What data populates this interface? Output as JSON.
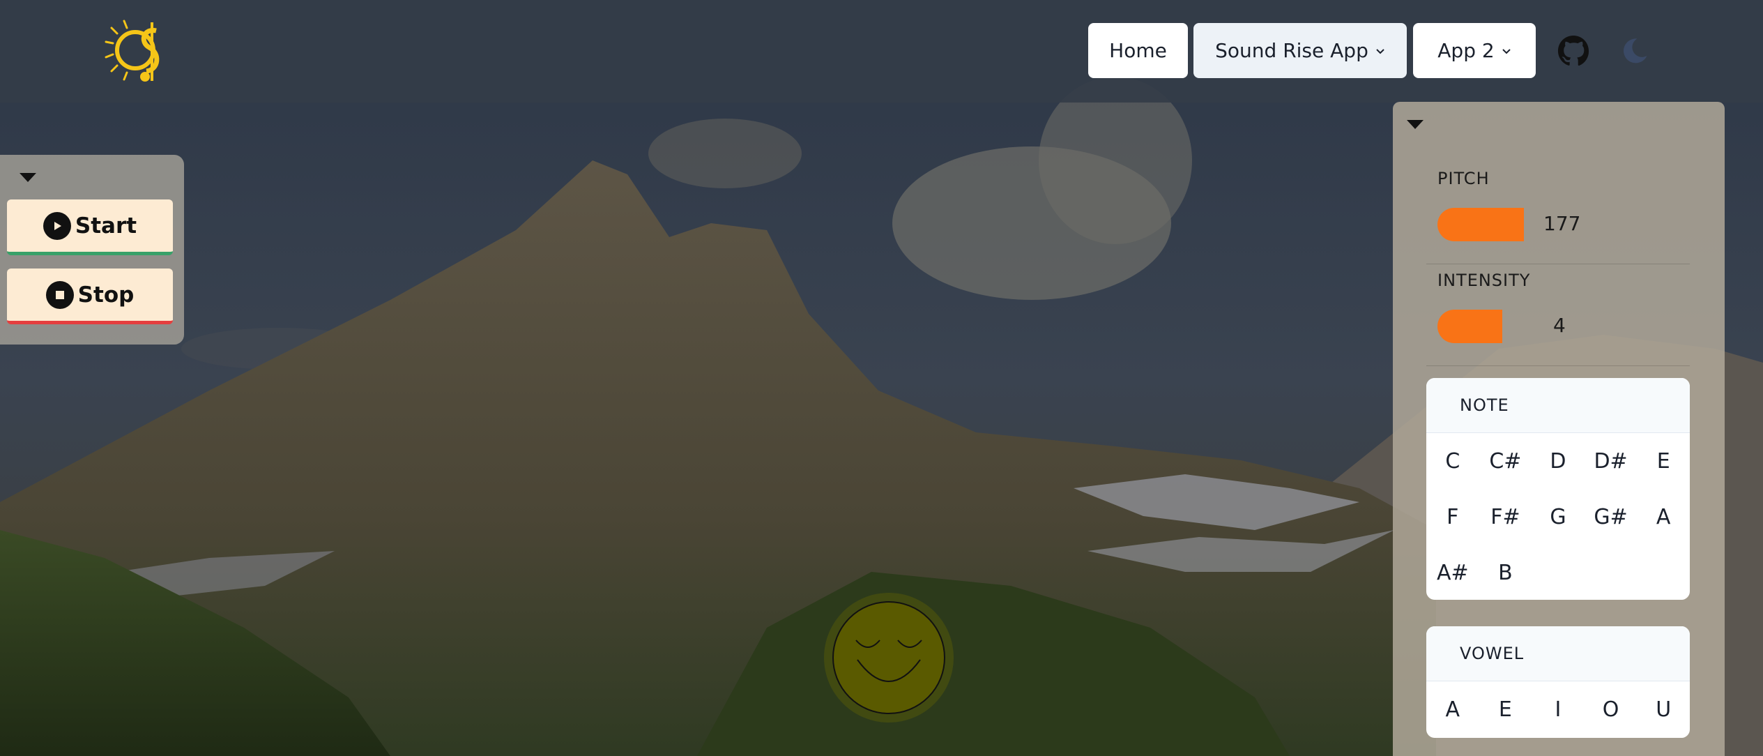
{
  "nav": {
    "home_label": "Home",
    "app1_label": "Sound Rise App",
    "app2_label": "App 2",
    "github_icon": "github-icon",
    "theme_icon": "moon-icon"
  },
  "controls": {
    "start_label": "Start",
    "stop_label": "Stop",
    "start_color": "#38a169",
    "stop_color": "#e53e3e"
  },
  "meters": {
    "pitch_label": "PITCH",
    "pitch_value": "177",
    "intensity_label": "INTENSITY",
    "intensity_value": "4",
    "bar_color": "#f97316"
  },
  "note": {
    "title": "NOTE",
    "options": [
      "C",
      "C#",
      "D",
      "D#",
      "E",
      "F",
      "F#",
      "G",
      "G#",
      "A",
      "A#",
      "B"
    ]
  },
  "vowel": {
    "title": "VOWEL",
    "options": [
      "A",
      "E",
      "I",
      "O",
      "U"
    ]
  },
  "colors": {
    "accent": "#f97316",
    "logo": "#f5c518",
    "smiley": "#5a5a00"
  }
}
